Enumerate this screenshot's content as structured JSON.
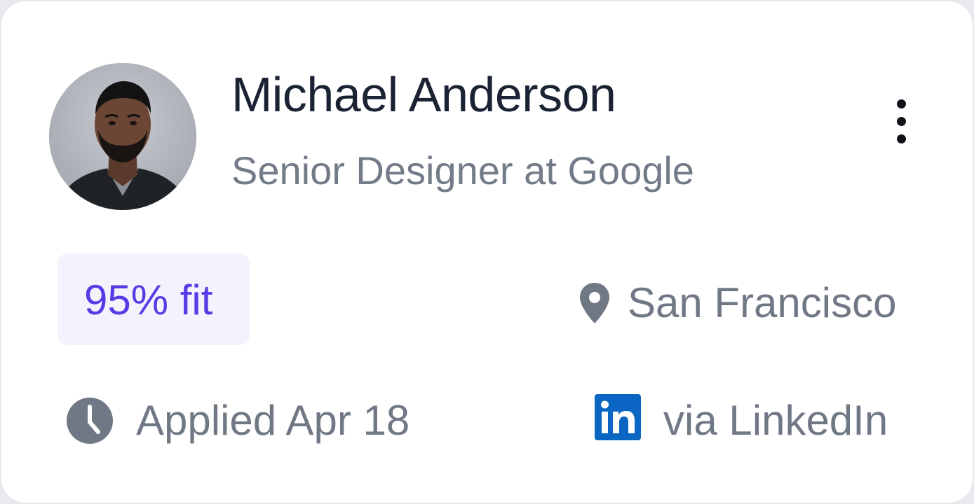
{
  "candidate": {
    "name": "Michael Anderson",
    "role": "Senior Designer at Google",
    "avatar_alt": "Michael Anderson"
  },
  "fit": {
    "label": "95% fit",
    "percent": 95
  },
  "location": {
    "text": "San Francisco",
    "icon": "map-pin-icon"
  },
  "applied": {
    "text": "Applied Apr 18",
    "icon": "clock-icon"
  },
  "source": {
    "text": "via LinkedIn",
    "icon": "linkedin-icon"
  },
  "colors": {
    "name": "#1b2233",
    "muted": "#717885",
    "fit_text": "#5a3ae4",
    "fit_bg": "#f3f2fd",
    "linkedin": "#0a66c2"
  }
}
